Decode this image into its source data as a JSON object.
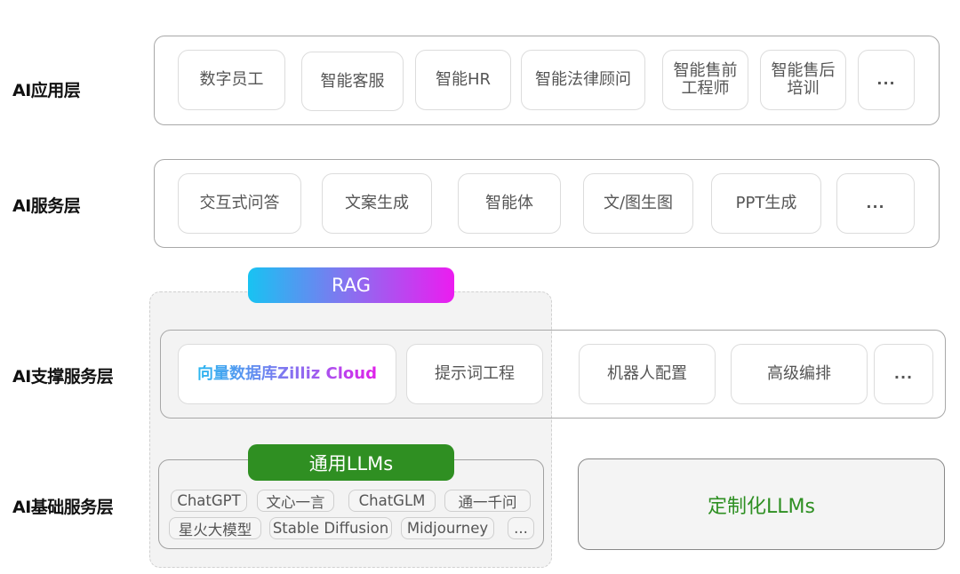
{
  "layers": {
    "application": {
      "label": "AI应用层",
      "items": [
        "数字员工",
        "智能客服",
        "智能HR",
        "智能法律顾问",
        "智能售前\n工程师",
        "智能售后\n培训",
        "..."
      ]
    },
    "service": {
      "label": "AI服务层",
      "items": [
        "交互式问答",
        "文案生成",
        "智能体",
        "文/图生图",
        "PPT生成",
        "..."
      ]
    },
    "support": {
      "label": "AI支撑服务层",
      "items": [
        "向量数据库Zilliz Cloud",
        "提示词工程",
        "机器人配置",
        "高级编排",
        "..."
      ]
    },
    "foundation": {
      "label": "AI基础服务层",
      "general_llms_title": "通用LLMs",
      "general_llms": [
        "ChatGPT",
        "文心一言",
        "ChatGLM",
        "通一千问",
        "星火大模型",
        "Stable Diffusion",
        "Midjourney",
        "..."
      ],
      "custom_llms": "定制化LLMs"
    }
  },
  "rag": {
    "label": "RAG"
  },
  "colors": {
    "rag_gradient_start": "#18c3f2",
    "rag_gradient_mid": "#8a6ff0",
    "rag_gradient_end": "#ec1cf0",
    "llm_green": "#2f8f22",
    "custom_llm_text": "#2e8f22"
  }
}
